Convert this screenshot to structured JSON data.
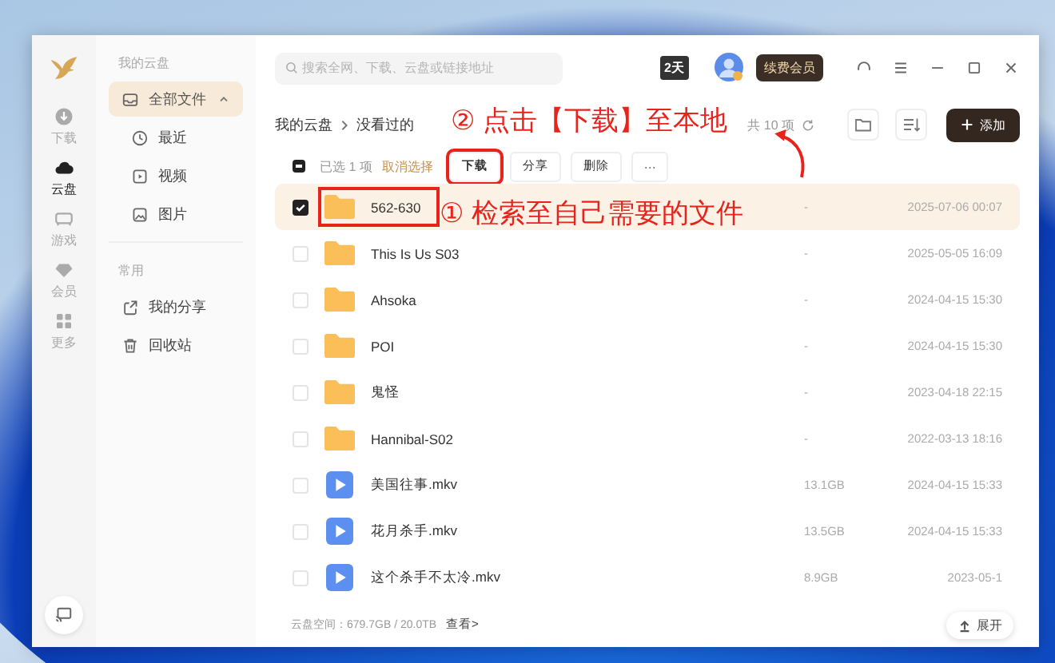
{
  "nav_rail": [
    {
      "label": "下载",
      "selected": false
    },
    {
      "label": "云盘",
      "selected": true
    },
    {
      "label": "游戏",
      "selected": false
    },
    {
      "label": "会员",
      "selected": false
    },
    {
      "label": "更多",
      "selected": false
    }
  ],
  "sidebar": {
    "section_title": "我的云盘",
    "items": [
      {
        "label": "全部文件",
        "selected": true,
        "expanded": true,
        "children": [
          {
            "label": "最近",
            "selected": false
          },
          {
            "label": "视频",
            "selected": false
          },
          {
            "label": "图片",
            "selected": false
          }
        ]
      }
    ],
    "common_title": "常用",
    "common_items": [
      {
        "label": "我的分享",
        "selected": false
      },
      {
        "label": "回收站",
        "selected": false
      }
    ]
  },
  "search": {
    "placeholder": "搜索全网、下载、云盘或链接地址"
  },
  "title_bar": {
    "days_badge": "2天",
    "vip_button": "续费会员"
  },
  "breadcrumb": [
    "我的云盘",
    "没看过的"
  ],
  "item_count": "共 10 项",
  "add_button": "添加",
  "selection_bar": {
    "select_all_indeterminate": true,
    "selected_count": "已选 1 项",
    "cancel": "取消选择",
    "actions": [
      "下载",
      "分享",
      "删除",
      "···"
    ]
  },
  "files": [
    {
      "kind": "folder",
      "name": "562-630",
      "size": "-",
      "date": "2025-07-06 00:07",
      "selected": true
    },
    {
      "kind": "folder",
      "name": "This Is Us S03",
      "size": "-",
      "date": "2025-05-05 16:09",
      "selected": false
    },
    {
      "kind": "folder",
      "name": "Ahsoka",
      "size": "-",
      "date": "2024-04-15 15:30",
      "selected": false
    },
    {
      "kind": "folder",
      "name": "POI",
      "size": "-",
      "date": "2024-04-15 15:30",
      "selected": false
    },
    {
      "kind": "folder",
      "name": "鬼怪",
      "size": "-",
      "date": "2023-04-18 22:15",
      "selected": false
    },
    {
      "kind": "folder",
      "name": "Hannibal-S02",
      "size": "-",
      "date": "2022-03-13 18:16",
      "selected": false
    },
    {
      "kind": "video",
      "name": "美国往事.mkv",
      "size": "13.1GB",
      "date": "2024-04-15 15:33",
      "selected": false
    },
    {
      "kind": "video",
      "name": "花月杀手.mkv",
      "size": "13.5GB",
      "date": "2024-04-15 15:33",
      "selected": false
    },
    {
      "kind": "video",
      "name": "这个杀手不太冷.mkv",
      "size": "8.9GB",
      "date": "2023-05-1",
      "selected": false
    }
  ],
  "footer": {
    "storage": "云盘空间：679.7GB / 20.0TB",
    "view_link": "查看>"
  },
  "expand_button": "展开",
  "annotations": {
    "step_download": "② 点击【下载】至本地",
    "step_search": "① 检索至自己需要的文件"
  }
}
